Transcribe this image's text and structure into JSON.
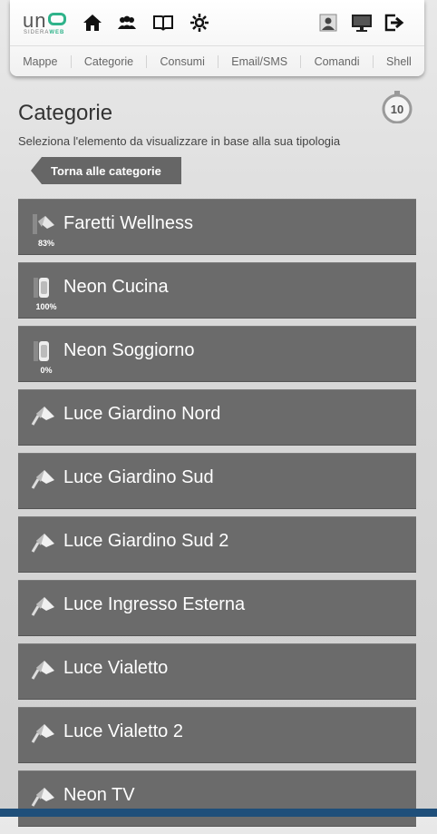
{
  "header": {
    "logo": {
      "word": "un",
      "tag_prefix": "SIDERA",
      "tag_suffix": "WEB"
    },
    "icons_left": [
      "home-icon",
      "users-icon",
      "book-icon",
      "settings-gear-icon"
    ],
    "icons_right": [
      "user-profile-icon",
      "monitor-icon",
      "logout-icon"
    ]
  },
  "nav": {
    "tabs": [
      "Mappe",
      "Categorie",
      "Consumi",
      "Email/SMS",
      "Comandi",
      "Shell"
    ]
  },
  "page": {
    "title": "Categorie",
    "subtitle": "Seleziona l'elemento da visualizzare in base alla sua tipologia",
    "timer_value": "10",
    "back_label": "Torna alle categorie"
  },
  "items": [
    {
      "label": "Faretti Wellness",
      "percent": "83%",
      "icon": "dimmer-light-icon"
    },
    {
      "label": "Neon Cucina",
      "percent": "100%",
      "icon": "neon-light-icon"
    },
    {
      "label": "Neon Soggiorno",
      "percent": "0%",
      "icon": "neon-light-icon"
    },
    {
      "label": "Luce Giardino Nord",
      "percent": "",
      "icon": "spotlight-icon"
    },
    {
      "label": "Luce Giardino Sud",
      "percent": "",
      "icon": "spotlight-icon"
    },
    {
      "label": "Luce Giardino Sud 2",
      "percent": "",
      "icon": "spotlight-icon"
    },
    {
      "label": "Luce Ingresso Esterna",
      "percent": "",
      "icon": "spotlight-icon"
    },
    {
      "label": "Luce Vialetto",
      "percent": "",
      "icon": "spotlight-icon"
    },
    {
      "label": "Luce Vialetto 2",
      "percent": "",
      "icon": "spotlight-icon"
    },
    {
      "label": "Neon TV",
      "percent": "",
      "icon": "spotlight-icon"
    }
  ],
  "colors": {
    "row_bg": "#6b6b6b",
    "logo_accent": "#2fb38a",
    "bottom_strip": "#1f4f7a"
  }
}
